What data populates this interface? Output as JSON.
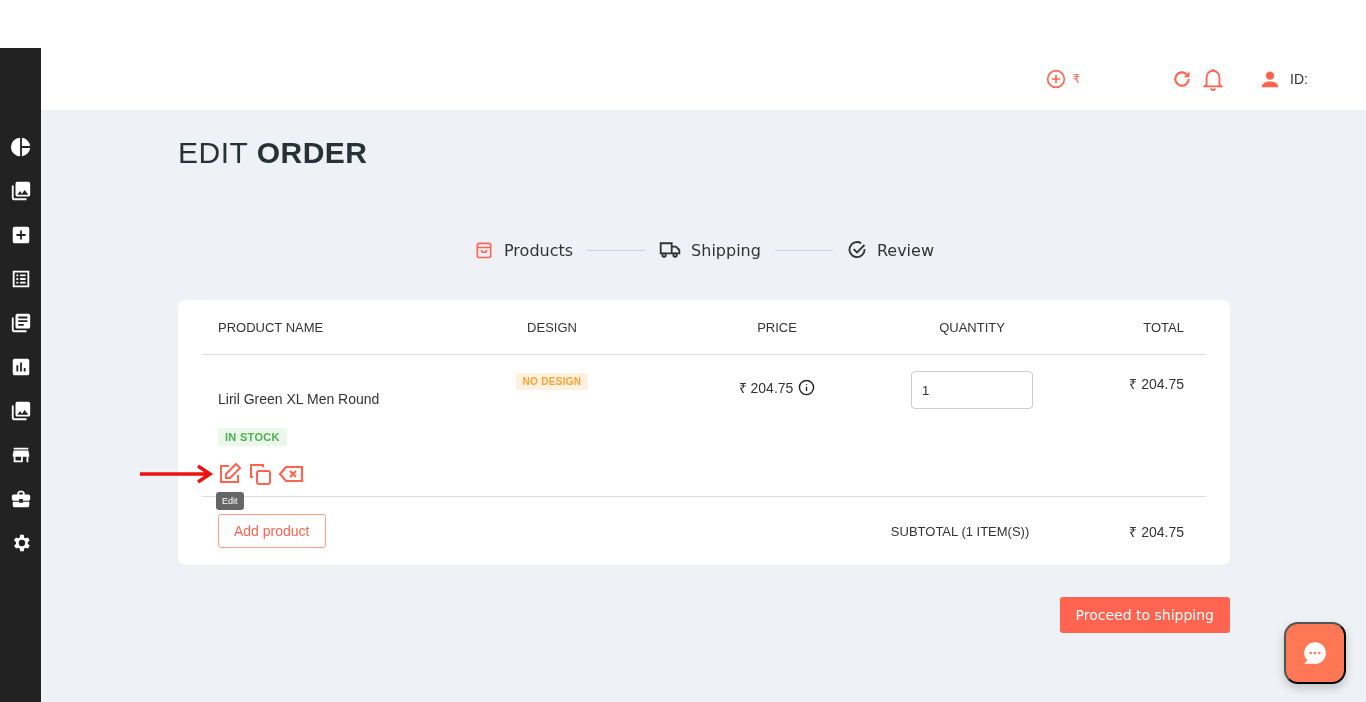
{
  "header": {
    "wallet_currency": "₹",
    "user_id_label": "ID:"
  },
  "page_title": {
    "light": "EDIT",
    "bold": "ORDER"
  },
  "steps": [
    {
      "label": "Products",
      "active": true
    },
    {
      "label": "Shipping",
      "active": false
    },
    {
      "label": "Review",
      "active": false
    }
  ],
  "table": {
    "columns": [
      "PRODUCT NAME",
      "DESIGN",
      "PRICE",
      "QUANTITY",
      "TOTAL"
    ],
    "rows": [
      {
        "name": "Liril Green XL Men Round",
        "stock": "IN STOCK",
        "design": "NO DESIGN",
        "price": "₹ 204.75",
        "quantity": "1",
        "total": "₹ 204.75",
        "tooltip": "Edit"
      }
    ],
    "add_button": "Add product",
    "subtotal_label": "SUBTOTAL (1 ITEM(S))",
    "subtotal": "₹ 204.75"
  },
  "proceed_button": "Proceed to shipping"
}
